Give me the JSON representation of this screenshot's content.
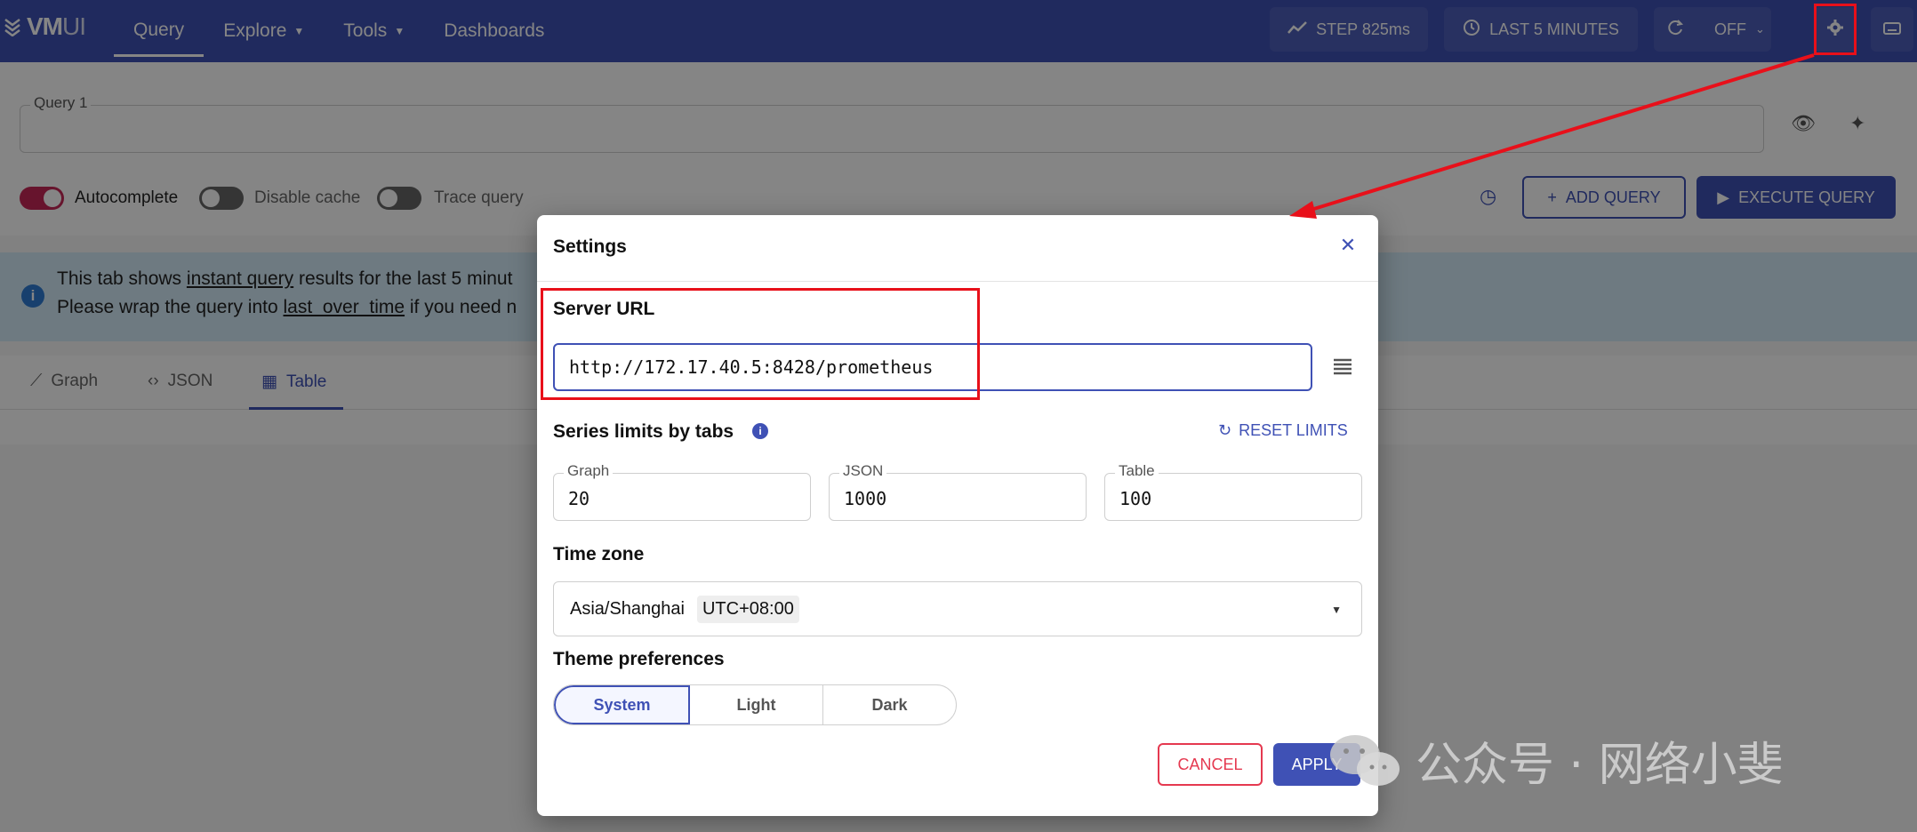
{
  "header": {
    "logo_text": "VM",
    "logo_text_suffix": "UI",
    "nav": [
      {
        "label": "Query"
      },
      {
        "label": "Explore"
      },
      {
        "label": "Tools"
      },
      {
        "label": "Dashboards"
      }
    ],
    "step_label": "STEP 825ms",
    "time_range_label": "LAST 5 MINUTES",
    "refresh_label": "OFF"
  },
  "query": {
    "label": "Query 1",
    "value": ""
  },
  "toggles": [
    {
      "label": "Autocomplete",
      "on": true
    },
    {
      "label": "Disable cache",
      "on": false
    },
    {
      "label": "Trace query",
      "on": false
    }
  ],
  "buttons": {
    "add_query": "ADD QUERY",
    "execute_query": "EXECUTE QUERY"
  },
  "info": {
    "line1_prefix": "This tab shows ",
    "line1_link": "instant query",
    "line1_suffix": " results for the last 5 minut",
    "line2_prefix": "Please wrap the query into ",
    "line2_link": "last_over_time",
    "line2_suffix": " if you need n"
  },
  "tabs": [
    {
      "label": "Graph"
    },
    {
      "label": "JSON"
    },
    {
      "label": "Table"
    }
  ],
  "settings": {
    "title": "Settings",
    "server_url_title": "Server URL",
    "server_url_value": "http://172.17.40.5:8428/prometheus",
    "series_limits_title": "Series limits by tabs",
    "reset_limits": "RESET LIMITS",
    "limits": [
      {
        "label": "Graph",
        "value": "20"
      },
      {
        "label": "JSON",
        "value": "1000"
      },
      {
        "label": "Table",
        "value": "100"
      }
    ],
    "timezone_title": "Time zone",
    "timezone_value": "Asia/Shanghai",
    "timezone_offset": "UTC+08:00",
    "theme_title": "Theme preferences",
    "theme_options": [
      "System",
      "Light",
      "Dark"
    ],
    "theme_selected": "System",
    "cancel": "CANCEL",
    "apply": "APPLY"
  },
  "watermark": "公众号 · 网络小斐",
  "colors": {
    "primary": "#3f51b5",
    "annotation": "#e8101a",
    "cancel": "#e53950",
    "toggle_on": "#c62857"
  }
}
